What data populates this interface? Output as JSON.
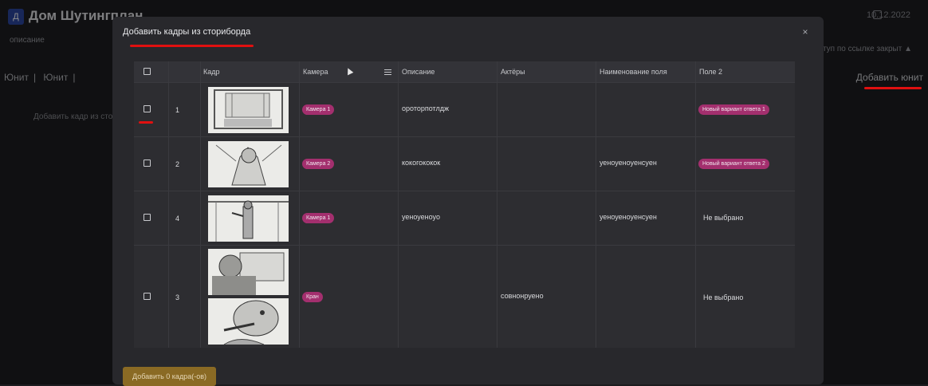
{
  "app": {
    "title": "Дом Шутингплан",
    "date": "10.12.2022",
    "description_label": "описание",
    "access_label": "Доступ по ссылке закрыт ▲",
    "units": [
      "Юнит",
      "Юнит"
    ],
    "add_unit_label": "Добавить юнит",
    "bg_hint": "Добавить кадр из сторибо"
  },
  "modal": {
    "title": "Добавить кадры из сториборда",
    "close_label": "×",
    "columns": [
      "Кадр",
      "Камера",
      "Описание",
      "Актёры",
      "Наименование поля",
      "Поле 2"
    ],
    "rows": [
      {
        "num": "1",
        "camera": "Камера 1",
        "description": "ороторпотлдж",
        "actors": "",
        "field_name": "",
        "field2": "Новый вариант ответа 1",
        "field2_tag": true
      },
      {
        "num": "2",
        "camera": "Камера 2",
        "description": "кокогококок",
        "actors": "",
        "field_name": "уеноуеноуенсуен",
        "field2": "Новый вариант ответа 2",
        "field2_tag": true
      },
      {
        "num": "4",
        "camera": "Камера 1",
        "description": "уеноуеноуо",
        "actors": "",
        "field_name": "уеноуеноуенсуен",
        "field2": "Не выбрано",
        "field2_tag": false
      },
      {
        "num": "3",
        "camera": "Кран",
        "description": "",
        "actors": "совнонруено",
        "field_name": "",
        "field2": "Не выбрано",
        "field2_tag": false
      }
    ],
    "footer_button": "Добавить 0 кадра(-ов)"
  },
  "colors": {
    "accent_red": "#e01010",
    "tag_magenta": "#a32f6e",
    "footer_gold": "#8a6a24",
    "logo_blue": "#2d47a3"
  }
}
